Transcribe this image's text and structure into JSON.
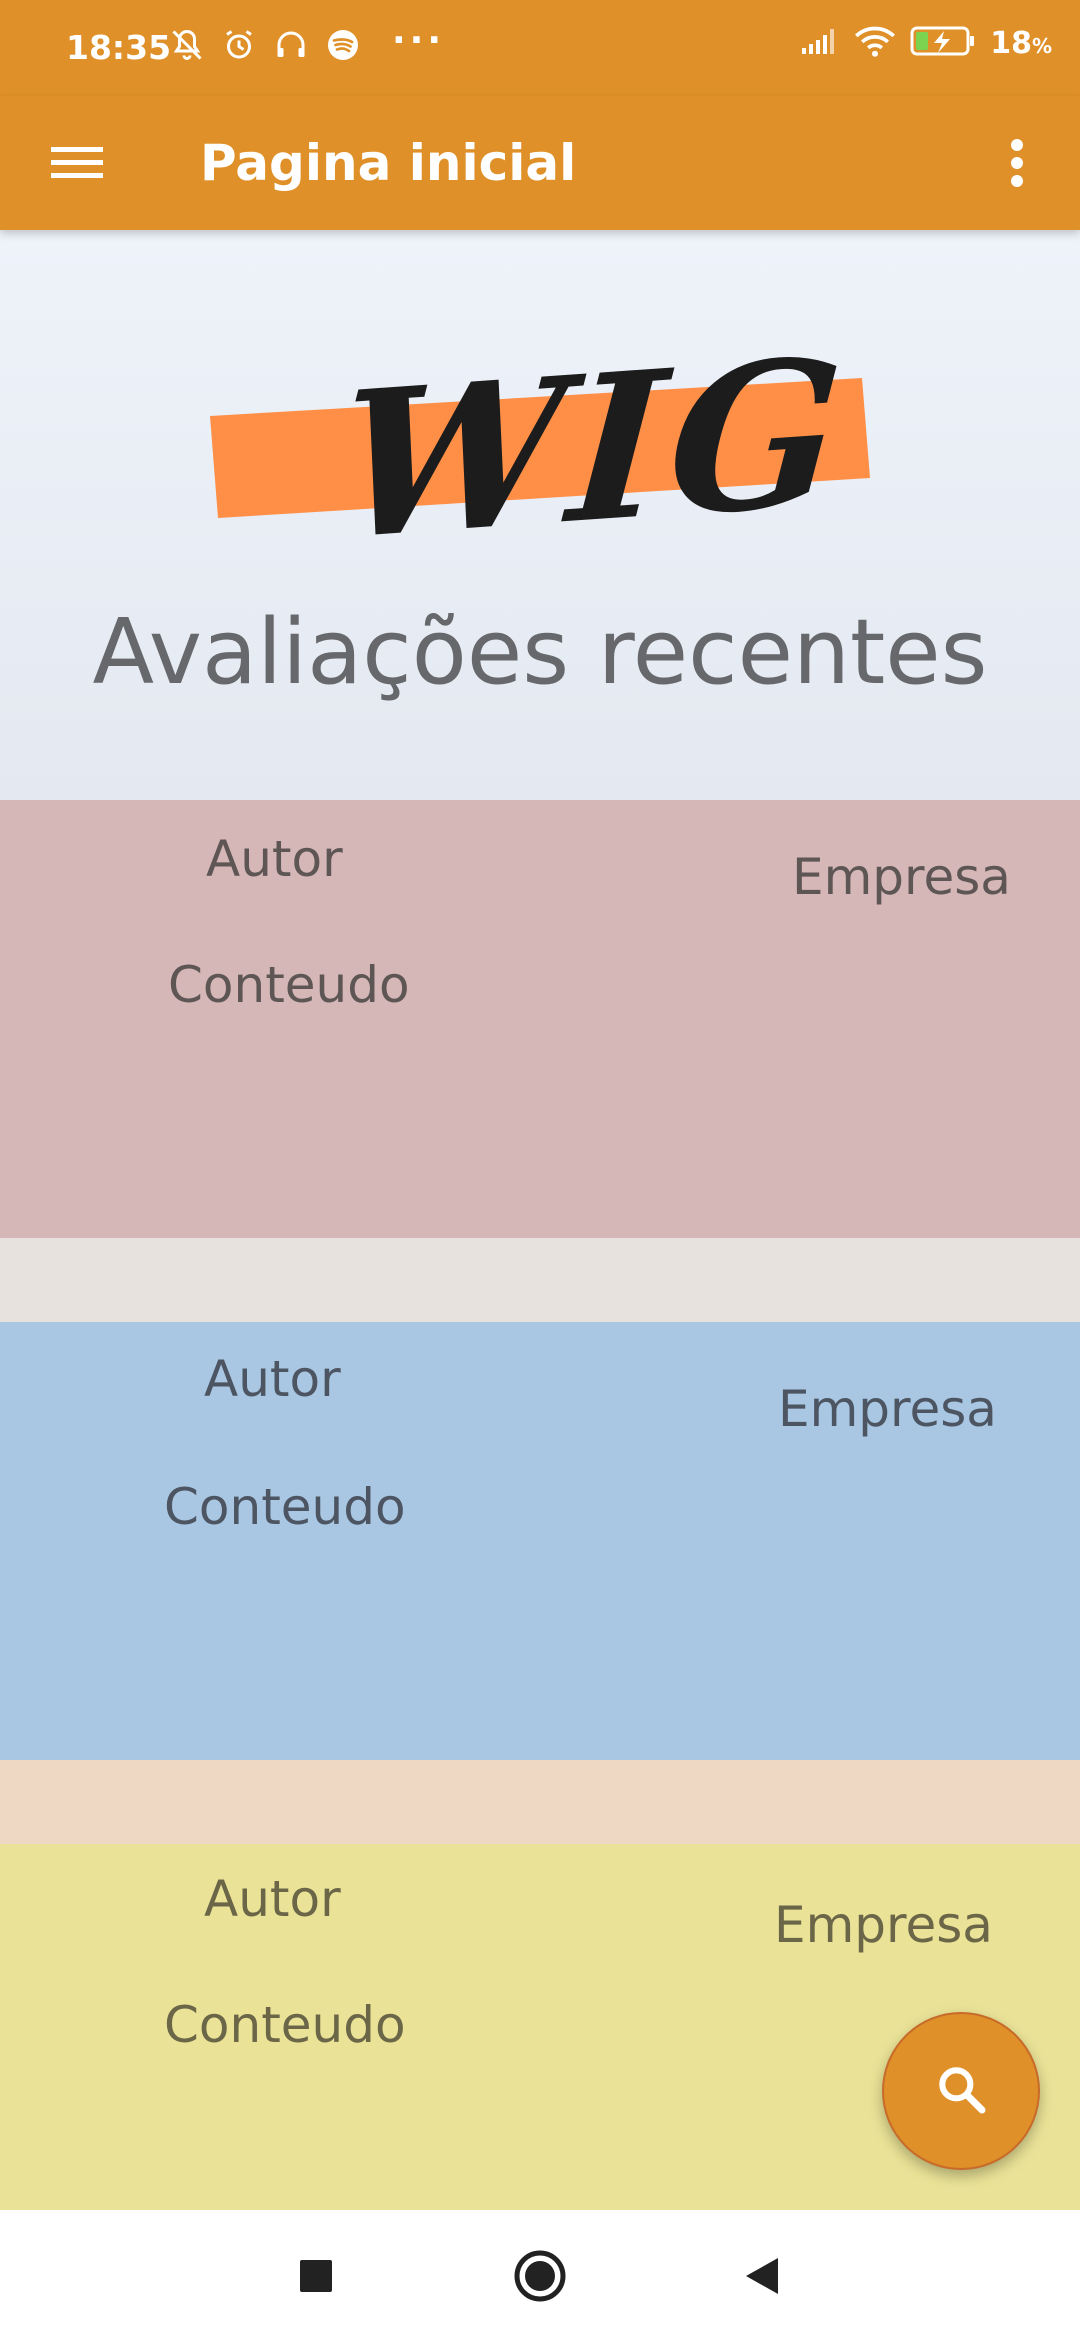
{
  "status_bar": {
    "time": "18:35",
    "more": "···",
    "battery_percent": "18",
    "battery_unit": "%",
    "icons_left": [
      "mute-icon",
      "alarm-icon",
      "headphones-icon",
      "spotify-icon"
    ],
    "icons_right": [
      "signal-icon",
      "wifi-icon",
      "battery-charging-icon"
    ]
  },
  "app_bar": {
    "title": "Pagina inicial",
    "menu_icon": "hamburger-menu-icon",
    "overflow_icon": "more-vert-icon",
    "color": "#DF9028"
  },
  "hero": {
    "logo_text": "WIG",
    "logo_accent": "#FF8F47",
    "title": "Avaliações recentes"
  },
  "reviews": [
    {
      "autor": "Autor",
      "conteudo": "Conteudo",
      "empresa": "Empresa",
      "color": "#D5B7B7"
    },
    {
      "autor": "Autor",
      "conteudo": "Conteudo",
      "empresa": "Empresa",
      "color": "#A9C7E3"
    },
    {
      "autor": "Autor",
      "conteudo": "Conteudo",
      "empresa": "Empresa",
      "color": "#EAE397"
    }
  ],
  "separators": [
    "#E8E2DF",
    "#EED8C3"
  ],
  "fab": {
    "icon": "search-icon",
    "color": "#DF9028"
  },
  "nav_bar": {
    "icons": [
      "recent-apps-icon",
      "home-icon",
      "back-icon"
    ]
  }
}
